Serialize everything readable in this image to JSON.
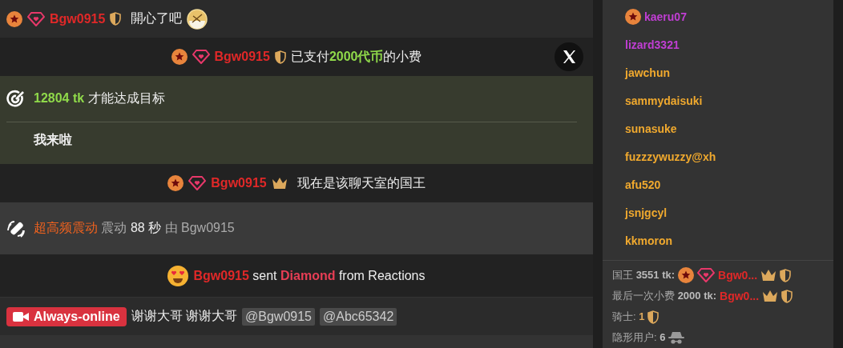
{
  "chat": [
    {
      "kind": "chat",
      "user": "Bgw0915",
      "text": "開心了吧"
    },
    {
      "kind": "tip",
      "user": "Bgw0915",
      "prefix": "已支付",
      "amount": "2000代币",
      "suffix": "的小费"
    },
    {
      "kind": "goal",
      "amount": "12804 tk",
      "text": "才能达成目标",
      "note": "我来啦"
    },
    {
      "kind": "king",
      "user": "Bgw0915",
      "text": "现在是该聊天室的国王"
    },
    {
      "kind": "vibe",
      "level_name": "超高频震动",
      "verb": "震动",
      "duration": "88 秒",
      "by": "由",
      "user": "Bgw0915"
    },
    {
      "kind": "reaction",
      "user": "Bgw0915",
      "sent": "sent",
      "gift": "Diamond",
      "from": "from Reactions"
    },
    {
      "kind": "badge",
      "badge": "Always-online",
      "text": "谢谢大哥 谢谢大哥",
      "mentions": [
        "@Bgw0915",
        "@Abc65342"
      ]
    }
  ],
  "users": [
    {
      "name": "kaeru07",
      "color": "#c13ed4",
      "star": true
    },
    {
      "name": "lizard3321",
      "color": "#c13ed4",
      "star": false
    },
    {
      "name": "jawchun",
      "color": "#f0a92e",
      "star": false
    },
    {
      "name": "sammydaisuki",
      "color": "#f0a92e",
      "star": false
    },
    {
      "name": "sunasuke",
      "color": "#f0a92e",
      "star": false
    },
    {
      "name": "fuzzzywuzzy@xh",
      "color": "#f0a92e",
      "star": false
    },
    {
      "name": "afu520",
      "color": "#f0a92e",
      "star": false
    },
    {
      "name": "jsnjgcyl",
      "color": "#f0a92e",
      "star": false
    },
    {
      "name": "kkmoron",
      "color": "#f0a92e",
      "star": false
    }
  ],
  "stats": [
    {
      "kind": "king",
      "label": "国王",
      "value": "3551 tk:",
      "user": "Bgw0..."
    },
    {
      "kind": "tip",
      "label": "最后一次小费",
      "value": "2000 tk:",
      "user": "Bgw0..."
    },
    {
      "kind": "knights",
      "label": "骑士:",
      "value": "1"
    },
    {
      "kind": "hidden",
      "label": "隐形用户:",
      "value": "6"
    }
  ]
}
